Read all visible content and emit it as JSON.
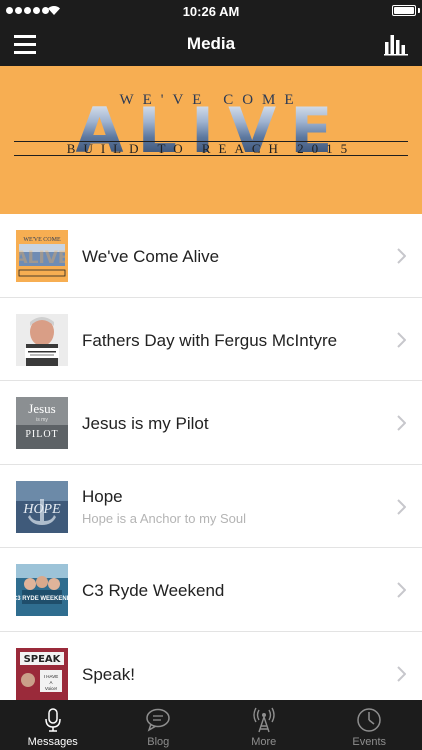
{
  "status_bar": {
    "time": "10:26 AM",
    "battery_level": 1.0
  },
  "nav": {
    "title": "Media",
    "menu_icon": "hamburger-icon",
    "stats_icon": "bar-chart-icon"
  },
  "banner": {
    "top_text": "WE'VE COME",
    "main_text": "ALIVE",
    "sub_text": "BUILD TO REACH 2015",
    "background": "#f7ae52"
  },
  "media_items": [
    {
      "title": "We've Come Alive",
      "subtitle": "",
      "thumb_text": "WE'VE COME ALIVE"
    },
    {
      "title": "Fathers Day with Fergus McIntyre",
      "subtitle": "",
      "thumb_text": "FERGUS MCINTYRE"
    },
    {
      "title": "Jesus is my Pilot",
      "subtitle": "",
      "thumb_text": "Jesus PILOT"
    },
    {
      "title": "Hope",
      "subtitle": "Hope is a Anchor to my Soul",
      "thumb_text": "HOPE"
    },
    {
      "title": "C3 Ryde Weekend",
      "subtitle": "",
      "thumb_text": "C3 RYDE WEEKEND"
    },
    {
      "title": "Speak!",
      "subtitle": "",
      "thumb_text": "SPEAK"
    }
  ],
  "tabs": [
    {
      "label": "Messages",
      "icon": "microphone-icon",
      "active": true
    },
    {
      "label": "Blog",
      "icon": "chat-bubble-icon",
      "active": false
    },
    {
      "label": "More",
      "icon": "broadcast-tower-icon",
      "active": false
    },
    {
      "label": "Events",
      "icon": "clock-icon",
      "active": false
    }
  ],
  "colors": {
    "bar_background": "#1c1c1c",
    "accent_orange": "#f7ae52",
    "subtitle_gray": "#b4b4b4"
  }
}
